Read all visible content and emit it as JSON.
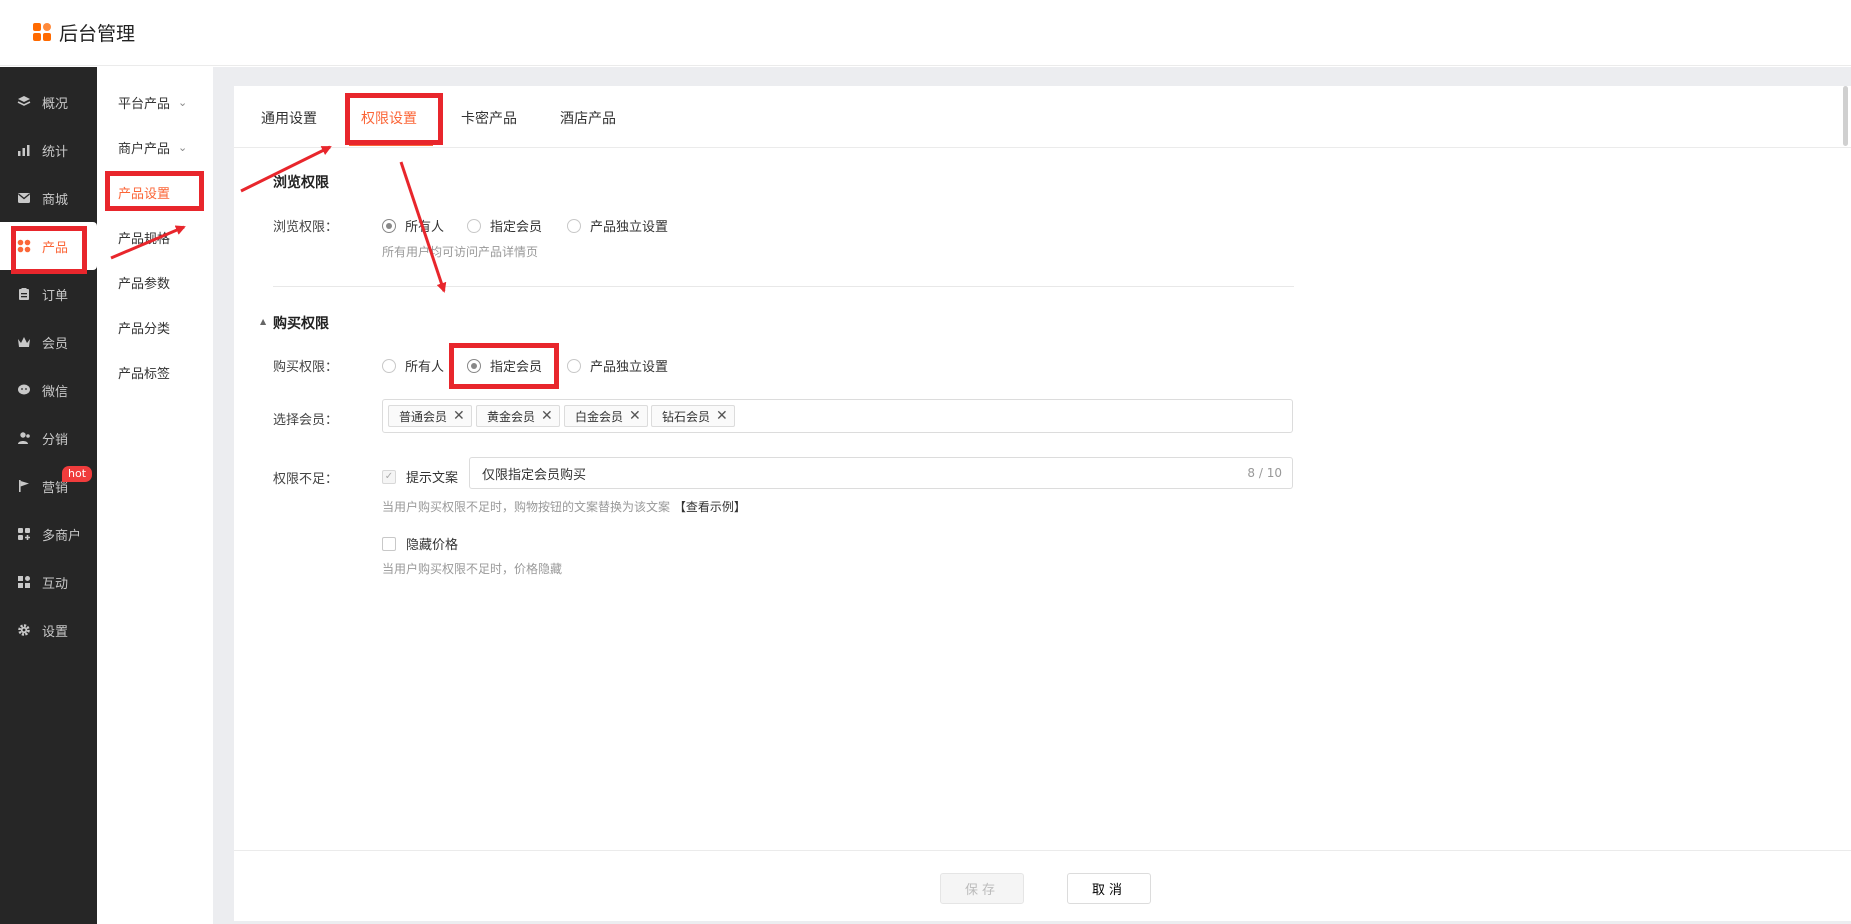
{
  "app": {
    "title": "后台管理"
  },
  "sidebar": {
    "items": [
      {
        "label": "概况",
        "icon": "layers-icon"
      },
      {
        "label": "统计",
        "icon": "chart-icon"
      },
      {
        "label": "商城",
        "icon": "mail-icon"
      },
      {
        "label": "产品",
        "icon": "grid-icon",
        "active": true
      },
      {
        "label": "订单",
        "icon": "clipboard-icon"
      },
      {
        "label": "会员",
        "icon": "crown-icon"
      },
      {
        "label": "微信",
        "icon": "wechat-icon"
      },
      {
        "label": "分销",
        "icon": "users-icon"
      },
      {
        "label": "营销",
        "icon": "flag-icon",
        "badge": "hot"
      },
      {
        "label": "多商户",
        "icon": "shop-icon"
      },
      {
        "label": "互动",
        "icon": "apps-icon"
      },
      {
        "label": "设置",
        "icon": "gear-icon"
      }
    ]
  },
  "subsidebar": {
    "items": [
      {
        "label": "平台产品",
        "expandable": true
      },
      {
        "label": "商户产品",
        "expandable": true
      },
      {
        "label": "产品设置",
        "active": true
      },
      {
        "label": "产品规格"
      },
      {
        "label": "产品参数"
      },
      {
        "label": "产品分类"
      },
      {
        "label": "产品标签"
      }
    ]
  },
  "tabs": [
    {
      "label": "通用设置"
    },
    {
      "label": "权限设置",
      "active": true
    },
    {
      "label": "卡密产品"
    },
    {
      "label": "酒店产品"
    }
  ],
  "browse": {
    "title": "浏览权限",
    "label": "浏览权限：",
    "options": [
      "所有人",
      "指定会员",
      "产品独立设置"
    ],
    "selected": "所有人",
    "hint": "所有用户均可访问产品详情页"
  },
  "purchase": {
    "title": "购买权限",
    "label": "购买权限：",
    "options": [
      "所有人",
      "指定会员",
      "产品独立设置"
    ],
    "selected": "指定会员",
    "members_label": "选择会员：",
    "members": [
      "普通会员",
      "黄金会员",
      "白金会员",
      "钻石会员"
    ],
    "insufficient_label": "权限不足：",
    "tip_checkbox": "提示文案",
    "tip_checked": true,
    "tip_value": "仅限指定会员购买",
    "tip_counter": "8 / 10",
    "tip_hint": "当用户购买权限不足时，购物按钮的文案替换为该文案",
    "tip_example": "【查看示例】",
    "hide_price_checkbox": "隐藏价格",
    "hide_price_checked": false,
    "hide_price_hint": "当用户购买权限不足时，价格隐藏"
  },
  "footer": {
    "save_label": "保存",
    "cancel_label": "取消"
  },
  "colors": {
    "accent": "#fb6638",
    "sidebar_bg": "#262626",
    "annotation": "#e8262c",
    "badge": "#f03c3c"
  }
}
